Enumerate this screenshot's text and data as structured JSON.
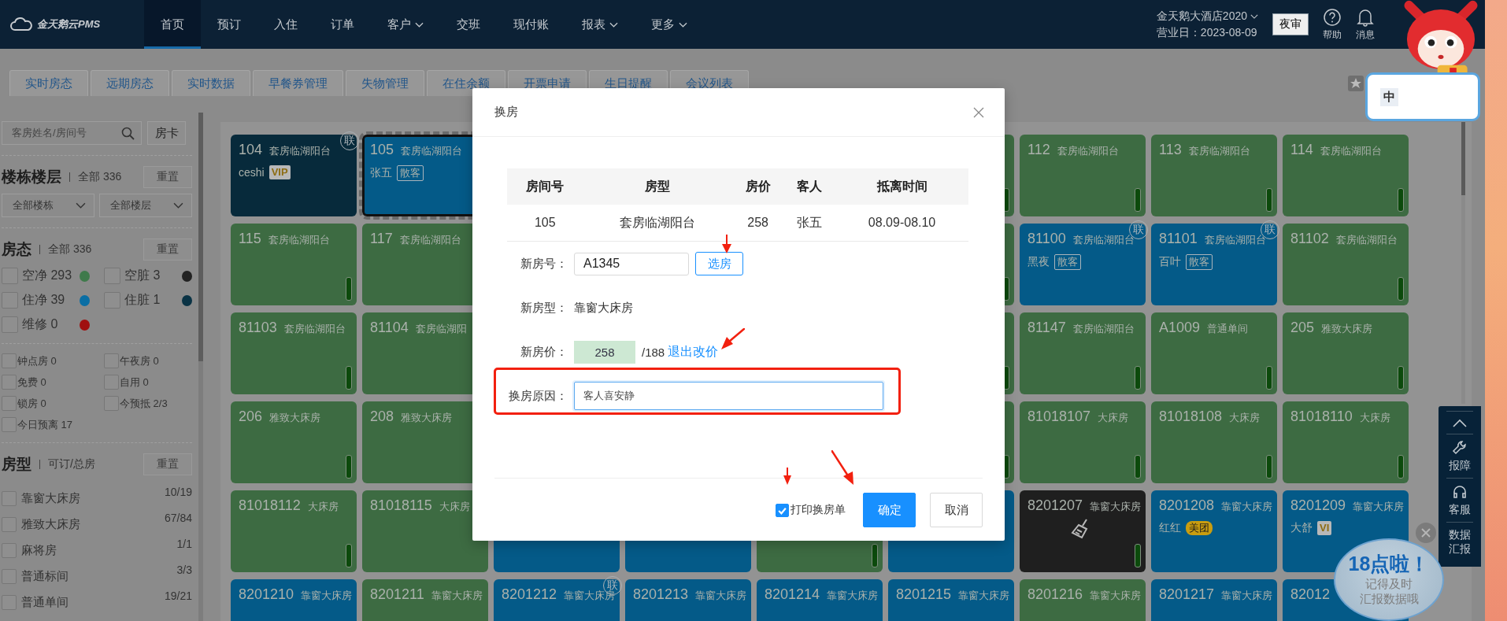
{
  "top_nav": {
    "logo": "金天鹅云PMS",
    "items": [
      {
        "label": "首页",
        "selected": true,
        "dropdown": false
      },
      {
        "label": "预订",
        "selected": false,
        "dropdown": false
      },
      {
        "label": "入住",
        "selected": false,
        "dropdown": false
      },
      {
        "label": "订单",
        "selected": false,
        "dropdown": false
      },
      {
        "label": "客户",
        "selected": false,
        "dropdown": true
      },
      {
        "label": "交班",
        "selected": false,
        "dropdown": false
      },
      {
        "label": "现付账",
        "selected": false,
        "dropdown": false
      },
      {
        "label": "报表",
        "selected": false,
        "dropdown": true
      },
      {
        "label": "更多",
        "selected": false,
        "dropdown": true
      }
    ],
    "hotel": "金天鹅大酒店2020",
    "business_date": "营业日：2023-08-09",
    "night_audit": "夜审",
    "help": "帮助",
    "messages": "消息"
  },
  "sub_tabs": [
    "实时房态",
    "远期房态",
    "实时数据",
    "早餐券管理",
    "失物管理",
    "在住余额",
    "开票申请",
    "生日提醒",
    "会议列表"
  ],
  "sidebar": {
    "search": {
      "placeholder": "客房姓名/房间号"
    },
    "room_card_button": "房卡",
    "floors": {
      "title": "楼栋楼层",
      "summary": "全部 336",
      "reset": "重置",
      "selects": [
        "全部楼栋",
        "全部楼层"
      ]
    },
    "status": {
      "title": "房态",
      "summary": "全部 336",
      "reset": "重置",
      "items": [
        {
          "label": "空净 293",
          "checked": false,
          "color": "#3f7a4b"
        },
        {
          "label": "空脏 3",
          "checked": false,
          "color": "#222222"
        },
        {
          "label": "住净 39",
          "checked": false,
          "color": "#0a6ea4"
        },
        {
          "label": "住脏 1",
          "checked": false,
          "color": "#0a3345"
        },
        {
          "label": "维修 0",
          "checked": false,
          "color": "#a01010"
        }
      ],
      "flags": [
        {
          "label": "钟点房 0",
          "checked": false
        },
        {
          "label": "午夜房 0",
          "checked": false
        },
        {
          "label": "免费 0",
          "checked": false
        },
        {
          "label": "自用 0",
          "checked": false
        },
        {
          "label": "锁房 0",
          "checked": false
        },
        {
          "label": "今预抵 2/3",
          "checked": false
        },
        {
          "label": "今日预离 17",
          "checked": false
        }
      ]
    },
    "room_types": {
      "title": "房型",
      "summary": "可订/总房",
      "reset": "重置",
      "items": [
        {
          "label": "靠窗大床房",
          "count": "10/19",
          "checked": false
        },
        {
          "label": "雅致大床房",
          "count": "67/84",
          "checked": false
        },
        {
          "label": "麻将房",
          "count": "1/1",
          "checked": false
        },
        {
          "label": "普通标间",
          "count": "3/3",
          "checked": false
        },
        {
          "label": "普通单间",
          "count": "19/21",
          "checked": false
        }
      ]
    }
  },
  "room_grid": {
    "rows": [
      [
        {
          "number": "104",
          "type": "套房临湖阳台",
          "color": "#072a3b",
          "selected": false,
          "badge": "联",
          "indicator": false,
          "cleaning": false,
          "guest": "ceshi",
          "tag": {
            "text": "VIP",
            "kind": "vip"
          }
        },
        {
          "number": "105",
          "type": "套房临湖阳台",
          "color": "#045a88",
          "selected": true,
          "cleaning": false,
          "guest": "张五",
          "tag": {
            "text": "散客",
            "kind": "source"
          }
        },
        null,
        null,
        null,
        {
          "color": "#3d6b42",
          "selected": false,
          "indicator": true
        },
        {
          "number": "112",
          "type": "套房临湖阳台",
          "color": "#3d6b42",
          "selected": false,
          "indicator": true,
          "cleaning": false
        },
        {
          "number": "113",
          "type": "套房临湖阳台",
          "color": "#3d6b42",
          "selected": false,
          "indicator": true,
          "cleaning": false
        },
        {
          "number": "114",
          "type": "套房临湖阳台",
          "color": "#3d6b42",
          "selected": false,
          "indicator": true,
          "cleaning": false
        }
      ],
      [
        {
          "number": "115",
          "type": "套房临湖阳台",
          "color": "#3d6b42",
          "selected": false,
          "indicator": true,
          "cleaning": false
        },
        {
          "number": "117",
          "type": "套房临湖阳台",
          "color": "#3d6b42",
          "selected": false,
          "cleaning": false
        },
        null,
        null,
        null,
        {
          "color": "#3d6b42",
          "selected": false,
          "indicator": true
        },
        {
          "number": "81100",
          "type": "套房临湖阳台",
          "color": "#045a88",
          "selected": false,
          "badge": "联",
          "indicator": false,
          "cleaning": false,
          "guest": "黑夜",
          "tag": {
            "text": "散客",
            "kind": "source"
          }
        },
        {
          "number": "81101",
          "type": "套房临湖阳台",
          "color": "#045a88",
          "selected": false,
          "badge": "联",
          "indicator": false,
          "cleaning": false,
          "guest": "百叶",
          "tag": {
            "text": "散客",
            "kind": "source"
          }
        },
        {
          "number": "81102",
          "type": "套房临湖阳台",
          "color": "#3d6b42",
          "selected": false,
          "indicator": true,
          "cleaning": false
        }
      ],
      [
        {
          "number": "81103",
          "type": "套房临湖阳台",
          "color": "#3d6b42",
          "selected": false,
          "indicator": true,
          "cleaning": false
        },
        {
          "number": "81104",
          "type": "套房临湖阳",
          "color": "#3d6b42",
          "selected": false,
          "cleaning": false
        },
        null,
        null,
        null,
        {
          "color": "#3d6b42",
          "selected": false,
          "indicator": true
        },
        {
          "number": "81147",
          "type": "套房临湖阳台",
          "color": "#3d6b42",
          "selected": false,
          "indicator": true,
          "cleaning": false
        },
        {
          "number": "A1009",
          "type": "普通单间",
          "color": "#3d6b42",
          "selected": false,
          "indicator": true,
          "cleaning": false
        },
        {
          "number": "205",
          "type": "雅致大床房",
          "color": "#3d6b42",
          "selected": false,
          "indicator": true,
          "cleaning": false
        }
      ],
      [
        {
          "number": "206",
          "type": "雅致大床房",
          "color": "#3d6b42",
          "selected": false,
          "indicator": true,
          "cleaning": false
        },
        {
          "number": "208",
          "type": "雅致大床房",
          "color": "#3d6b42",
          "selected": false,
          "cleaning": false
        },
        null,
        null,
        null,
        {
          "color": "#3d6b42",
          "selected": false,
          "indicator": true
        },
        {
          "number": "81018107",
          "type": "大床房",
          "color": "#3d6b42",
          "selected": false,
          "indicator": true,
          "cleaning": false
        },
        {
          "number": "81018108",
          "type": "大床房",
          "color": "#3d6b42",
          "selected": false,
          "indicator": true,
          "cleaning": false
        },
        {
          "number": "81018110",
          "type": "大床房",
          "color": "#3d6b42",
          "selected": false,
          "indicator": true,
          "cleaning": false
        }
      ],
      [
        {
          "number": "81018112",
          "type": "大床房",
          "color": "#3d6b42",
          "selected": false,
          "indicator": true,
          "cleaning": false
        },
        {
          "number": "81018115",
          "type": "大床房",
          "color": "#3d6b42",
          "selected": false,
          "cleaning": false
        },
        {
          "color": "#045a88",
          "selected": false
        },
        {
          "color": "#045a88",
          "selected": false
        },
        {
          "color": "#3d6b42",
          "selected": false,
          "indicator": true
        },
        {
          "color": "#045a88",
          "selected": false
        },
        {
          "number": "8201207",
          "type": "靠窗大床房",
          "color": "#1f1f1f",
          "selected": false,
          "indicator": true,
          "cleaning": true
        },
        {
          "number": "8201208",
          "type": "靠窗大床房",
          "color": "#045a88",
          "selected": false,
          "indicator": false,
          "cleaning": false,
          "guest": "红红",
          "tag": {
            "text": "美团",
            "kind": "meituan"
          }
        },
        {
          "number": "8201209",
          "type": "靠窗大床房",
          "color": "#045a88",
          "selected": false,
          "cleaning": false,
          "guest": "大舒",
          "tag": {
            "text": "VI",
            "kind": "vip"
          }
        }
      ],
      [
        {
          "number": "8201210",
          "type": "靠窗大床房",
          "color": "#045a88",
          "selected": false
        },
        {
          "number": "8201211",
          "type": "靠窗大床房",
          "color": "#3d6b42",
          "selected": false
        },
        {
          "number": "8201212",
          "type": "靠窗大床房",
          "color": "#045a88",
          "selected": false,
          "badge": "联"
        },
        {
          "number": "8201213",
          "type": "靠窗大床房",
          "color": "#045a88",
          "selected": false
        },
        {
          "number": "8201214",
          "type": "靠窗大床房",
          "color": "#045a88",
          "selected": false
        },
        {
          "number": "8201215",
          "type": "靠窗大床房",
          "color": "#045a88",
          "selected": false
        },
        {
          "number": "8201216",
          "type": "靠窗大床房",
          "color": "#3d6b42",
          "selected": false
        },
        {
          "number": "8201217",
          "type": "靠窗大床房",
          "color": "#045a88",
          "selected": false
        },
        {
          "number": "82012",
          "color": "#045a88",
          "selected": false
        }
      ]
    ]
  },
  "dialog": {
    "title": "换房",
    "table": {
      "columns": [
        "房间号",
        "房型",
        "房价",
        "客人",
        "抵离时间"
      ],
      "rows": [
        [
          "105",
          "套房临湖阳台",
          "258",
          "张五",
          "08.09-08.10"
        ]
      ]
    },
    "new_room": {
      "label": "新房号：",
      "value": "A1345",
      "button": "选房"
    },
    "new_type": {
      "label": "新房型：",
      "value": "靠窗大床房"
    },
    "new_price": {
      "label": "新房价：",
      "value": "258",
      "original": "/188",
      "link": "退出改价"
    },
    "reason": {
      "label": "换房原因：",
      "value": "客人喜安静"
    },
    "print": {
      "label": "打印换房单",
      "checked": true
    },
    "buttons": [
      {
        "label": "确定",
        "kind": "primary"
      },
      {
        "label": "取消",
        "kind": "default"
      }
    ]
  },
  "annotations": [
    {
      "kind": "frame"
    },
    {
      "kind": "arrow"
    },
    {
      "kind": "arrow"
    },
    {
      "kind": "arrow"
    },
    {
      "kind": "arrow"
    }
  ],
  "side_tools": [
    {
      "kind": "top"
    },
    {
      "kind": "repair",
      "label": "报障"
    },
    {
      "kind": "service",
      "label": "客服"
    },
    {
      "kind": "report",
      "label": "数据汇报"
    }
  ],
  "reminder": {
    "title": "18点啦！",
    "lines": [
      "记得及时",
      "汇报数据哦"
    ]
  },
  "ime": {
    "mode": "中"
  }
}
